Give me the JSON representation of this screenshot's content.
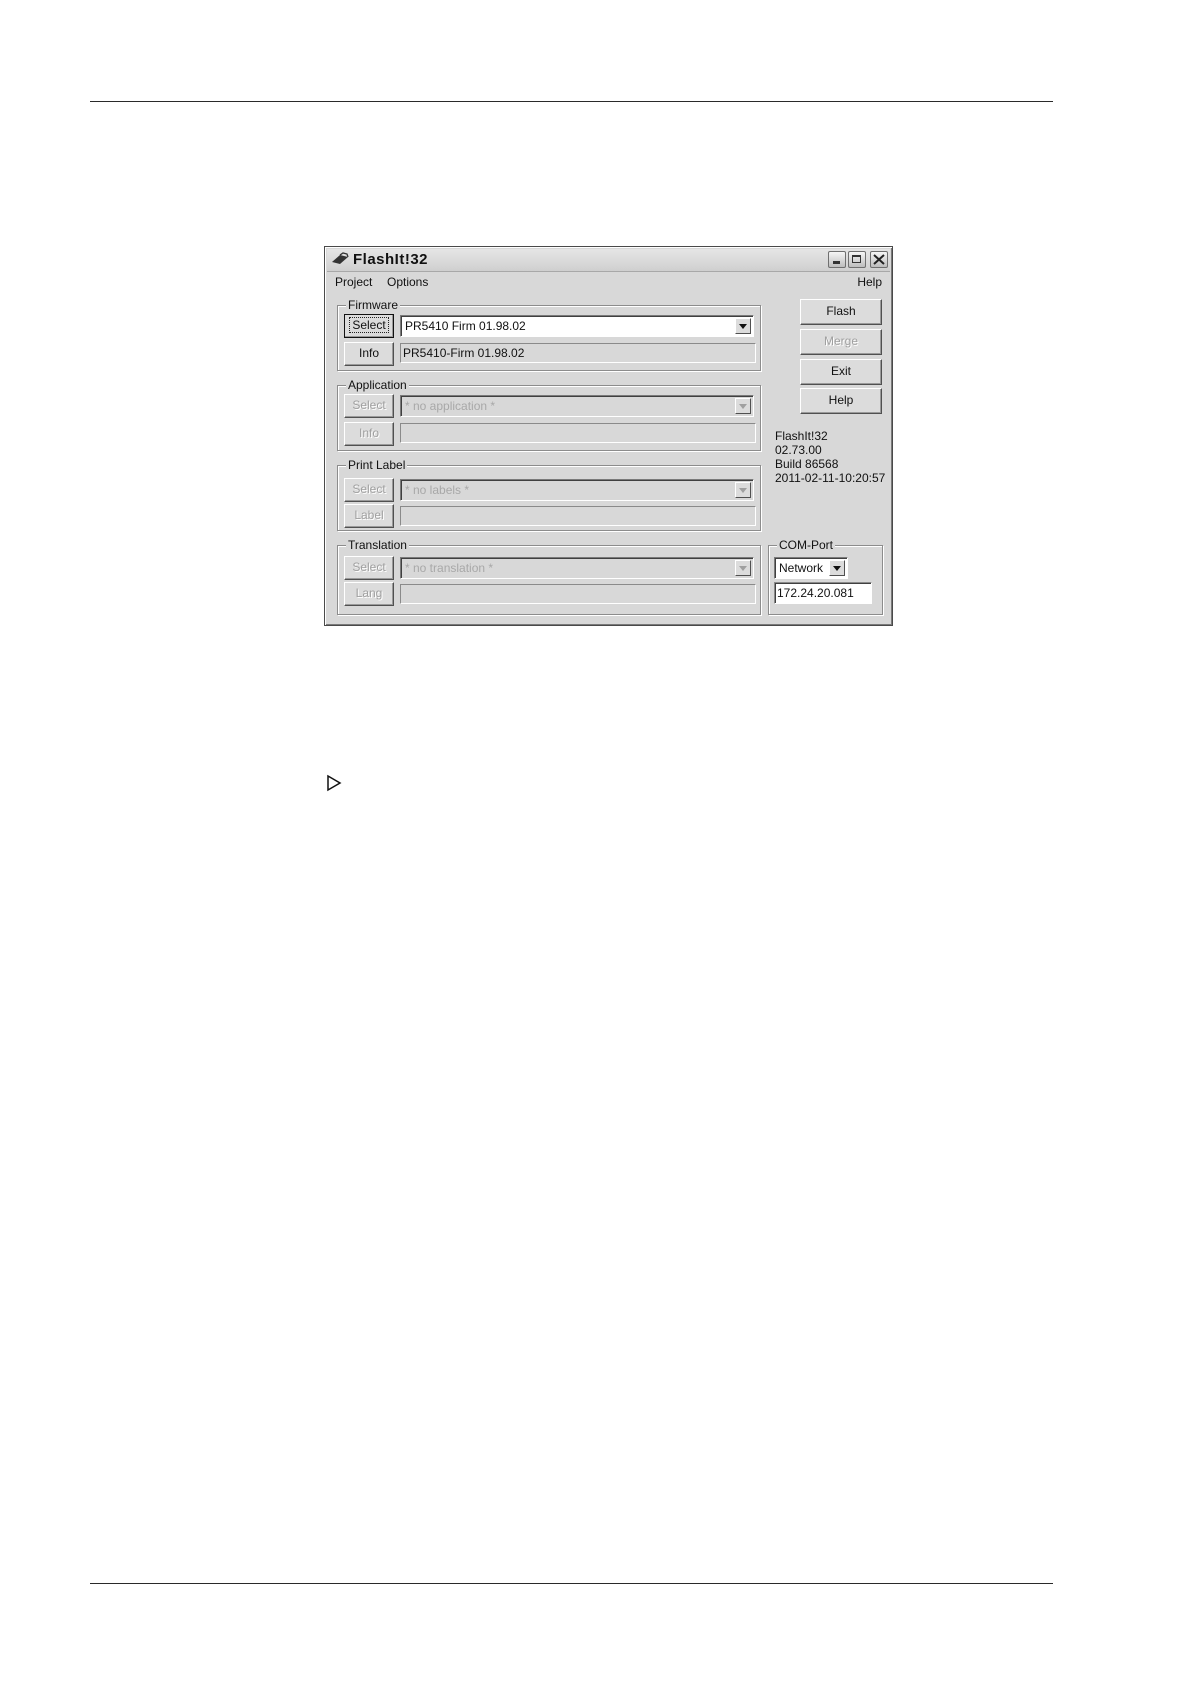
{
  "window": {
    "title": "FlashIt!32",
    "icon": "flash-chip-icon"
  },
  "menu": {
    "project": "Project",
    "options": "Options",
    "help": "Help"
  },
  "firmware": {
    "label": "Firmware",
    "select_label": "Select",
    "info_label": "Info",
    "combo_value": "PR5410 Firm 01.98.02",
    "info_value": "PR5410-Firm 01.98.02"
  },
  "application": {
    "label": "Application",
    "select_label": "Select",
    "info_label": "Info",
    "combo_value": "* no application *",
    "info_value": ""
  },
  "print_label": {
    "label": "Print Label",
    "select_label": "Select",
    "label_label": "Label",
    "combo_value": "* no labels *",
    "info_value": ""
  },
  "translation": {
    "label": "Translation",
    "select_label": "Select",
    "lang_label": "Lang",
    "combo_value": "* no translation *",
    "info_value": ""
  },
  "actions": {
    "flash": "Flash",
    "merge": "Merge",
    "exit": "Exit",
    "help": "Help"
  },
  "version_info": {
    "name": "FlashIt!32",
    "version": "02.73.00",
    "build": "Build 86568",
    "timestamp": "2011-02-11-10:20:57"
  },
  "com_port": {
    "label": "COM-Port",
    "selected": "Network",
    "address": "172.24.20.081"
  },
  "bullet_icon": "triangle-right-icon"
}
